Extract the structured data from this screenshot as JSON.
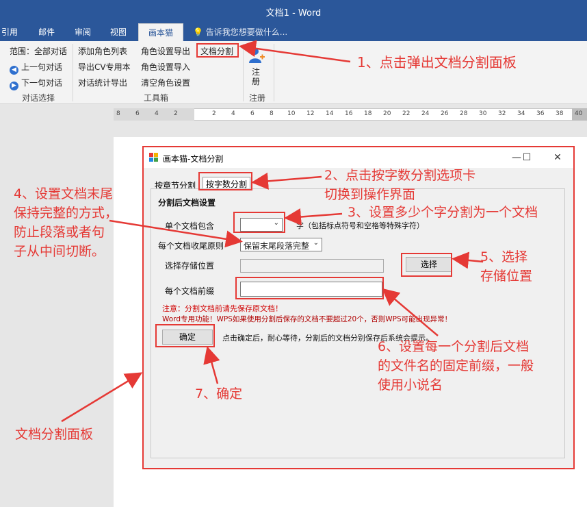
{
  "window": {
    "title": "文档1 - Word"
  },
  "tabs": [
    "引用",
    "邮件",
    "审阅",
    "视图",
    "画本猫"
  ],
  "tell_me": "告诉我您想要做什么...",
  "ribbon": {
    "col1": [
      "范围：全部对话",
      "上一句对话",
      "下一句对话"
    ],
    "col1_group": "对话选择",
    "col2": [
      "添加角色列表",
      "导出CV专用本",
      "对话统计导出"
    ],
    "col3": [
      "角色设置导出",
      "角色设置导入",
      "清空角色设置"
    ],
    "col4": "文档分割",
    "tools_group": "工具箱",
    "register_button": "注\n册",
    "register_group": "注册"
  },
  "ruler": [
    "8",
    "6",
    "4",
    "2",
    "2",
    "4",
    "6",
    "8",
    "10",
    "12",
    "14",
    "16",
    "18",
    "20",
    "22",
    "24",
    "26",
    "28",
    "30",
    "32",
    "34",
    "36",
    "38",
    "40"
  ],
  "dialog": {
    "title": "画本猫-文档分割",
    "tab_chapter": "按章节分割",
    "tab_words": "按字数分割",
    "section_title": "分割后文档设置",
    "label_words": "单个文档包含",
    "word_count_value": "",
    "word_unit": "字（包括标点符号和空格等特殊字符）",
    "label_ending": "每个文档收尾原则",
    "ending_value": "保留末尾段落完整",
    "label_path": "选择存储位置",
    "path_value": "",
    "choose_button": "选择",
    "label_prefix": "每个文档前缀",
    "prefix_value": "",
    "note1": "注意：分割文档前请先保存原文档！",
    "note2": "Word专用功能！WPS如果使用分割后保存的文档不要超过20个，否则WPS可能出现异常！",
    "ok_button": "确定",
    "ok_hint": "点击确定后，耐心等待，分割后的文档分别保存后系统会提示。"
  },
  "annotations": {
    "a1": "1、点击弹出文档分割面板",
    "a2a": "2、点击按字数分割选项卡",
    "a2b": "切换到操作界面",
    "a3": "3、设置多少个字分割为一个文档",
    "a4": [
      "4、设置文档末尾",
      "保持完整的方式，",
      "防止段落或者句",
      "子从中间切断。"
    ],
    "a5": [
      "5、选择",
      "存储位置"
    ],
    "a6": [
      "6、设置每一个分割后文档",
      "的文件名的固定前缀，一般",
      "使用小说名"
    ],
    "a7": "7、确定",
    "a8": "文档分割面板"
  },
  "colors": {
    "accent": "#2b579a",
    "annotation": "#e53935"
  }
}
